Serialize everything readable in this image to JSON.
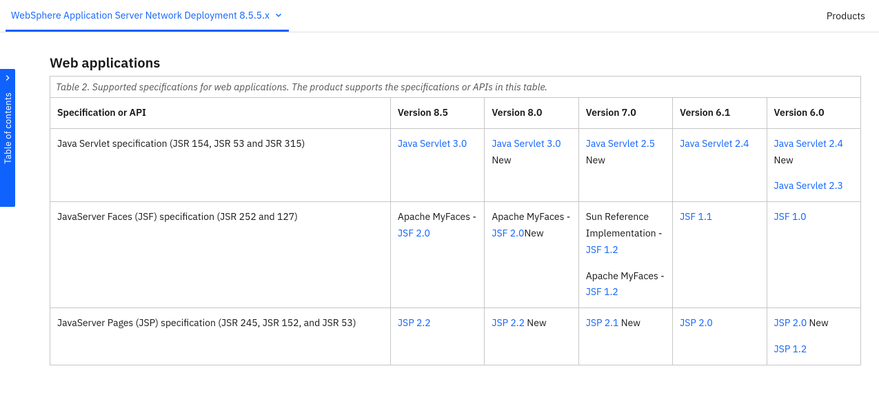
{
  "topbar": {
    "version_label": "WebSphere Application Server Network Deployment 8.5.5.x",
    "products_label": "Products"
  },
  "toc": {
    "label": "Table of contents"
  },
  "section": {
    "title": "Web applications",
    "caption": "Table 2. Supported specifications for web applications. The product supports the specifications or APIs in this table.",
    "columns": [
      "Specification or API",
      "Version 8.5",
      "Version 8.0",
      "Version 7.0",
      "Version 6.1",
      "Version 6.0"
    ],
    "rows": [
      {
        "spec": "Java Servlet specification (JSR 154, JSR 53 and JSR 315)",
        "v85": [
          {
            "parts": [
              {
                "t": "link",
                "v": "Java Servlet 3.0"
              }
            ]
          }
        ],
        "v80": [
          {
            "parts": [
              {
                "t": "link",
                "v": "Java Servlet 3.0"
              },
              {
                "t": "text",
                "v": " New"
              }
            ]
          }
        ],
        "v70": [
          {
            "parts": [
              {
                "t": "link",
                "v": "Java Servlet 2.5"
              },
              {
                "t": "text",
                "v": " New"
              }
            ]
          }
        ],
        "v61": [
          {
            "parts": [
              {
                "t": "link",
                "v": "Java Servlet 2.4"
              }
            ]
          }
        ],
        "v60": [
          {
            "parts": [
              {
                "t": "link",
                "v": "Java Servlet 2.4"
              },
              {
                "t": "text",
                "v": " New"
              }
            ]
          },
          {
            "parts": [
              {
                "t": "link",
                "v": "Java Servlet 2.3"
              }
            ]
          }
        ]
      },
      {
        "spec": "JavaServer Faces (JSF) specification (JSR 252 and 127)",
        "v85": [
          {
            "parts": [
              {
                "t": "text",
                "v": "Apache MyFaces - "
              },
              {
                "t": "link",
                "v": "JSF 2.0"
              }
            ]
          }
        ],
        "v80": [
          {
            "parts": [
              {
                "t": "text",
                "v": "Apache MyFaces - "
              },
              {
                "t": "link",
                "v": "JSF 2.0"
              },
              {
                "t": "text",
                "v": "New"
              }
            ]
          }
        ],
        "v70": [
          {
            "parts": [
              {
                "t": "text",
                "v": "Sun Reference Implementation - "
              },
              {
                "t": "link",
                "v": "JSF 1.2"
              }
            ]
          },
          {
            "parts": [
              {
                "t": "text",
                "v": "Apache MyFaces - "
              },
              {
                "t": "link",
                "v": "JSF 1.2"
              }
            ]
          }
        ],
        "v61": [
          {
            "parts": [
              {
                "t": "link",
                "v": "JSF 1.1"
              }
            ]
          }
        ],
        "v60": [
          {
            "parts": [
              {
                "t": "link",
                "v": "JSF 1.0"
              }
            ]
          }
        ]
      },
      {
        "spec": "JavaServer Pages (JSP) specification (JSR 245, JSR 152, and JSR 53)",
        "v85": [
          {
            "parts": [
              {
                "t": "link",
                "v": "JSP 2.2"
              }
            ]
          }
        ],
        "v80": [
          {
            "parts": [
              {
                "t": "link",
                "v": "JSP 2.2"
              },
              {
                "t": "text",
                "v": " New"
              }
            ]
          }
        ],
        "v70": [
          {
            "parts": [
              {
                "t": "link",
                "v": "JSP 2.1"
              },
              {
                "t": "text",
                "v": " New"
              }
            ]
          }
        ],
        "v61": [
          {
            "parts": [
              {
                "t": "link",
                "v": "JSP 2.0"
              }
            ]
          }
        ],
        "v60": [
          {
            "parts": [
              {
                "t": "link",
                "v": "JSP 2.0"
              },
              {
                "t": "text",
                "v": " New"
              }
            ]
          },
          {
            "parts": [
              {
                "t": "link",
                "v": "JSP 1.2"
              }
            ]
          }
        ]
      }
    ]
  }
}
